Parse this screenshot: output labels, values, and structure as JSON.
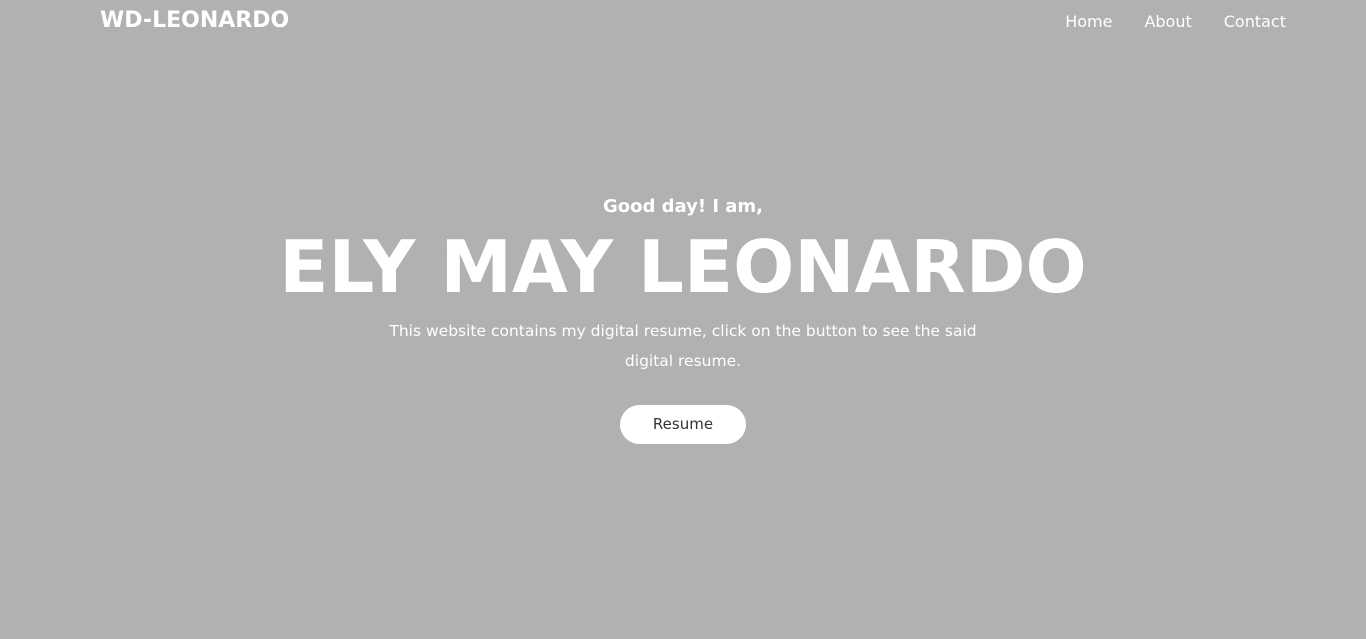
{
  "navbar": {
    "brand": "WD-LEONARDO",
    "links": [
      "Home",
      "About",
      "Contact"
    ]
  },
  "hero": {
    "greeting": "Good day! I am,",
    "name": "ELY MAY LEONARDO",
    "description": "This website contains my digital resume, click on the button to see the said digital resume.",
    "button_label": "Resume"
  },
  "colors": {
    "background": "#b1b1b1",
    "text": "#ffffff",
    "button_bg": "#ffffff",
    "button_text": "#333333"
  }
}
